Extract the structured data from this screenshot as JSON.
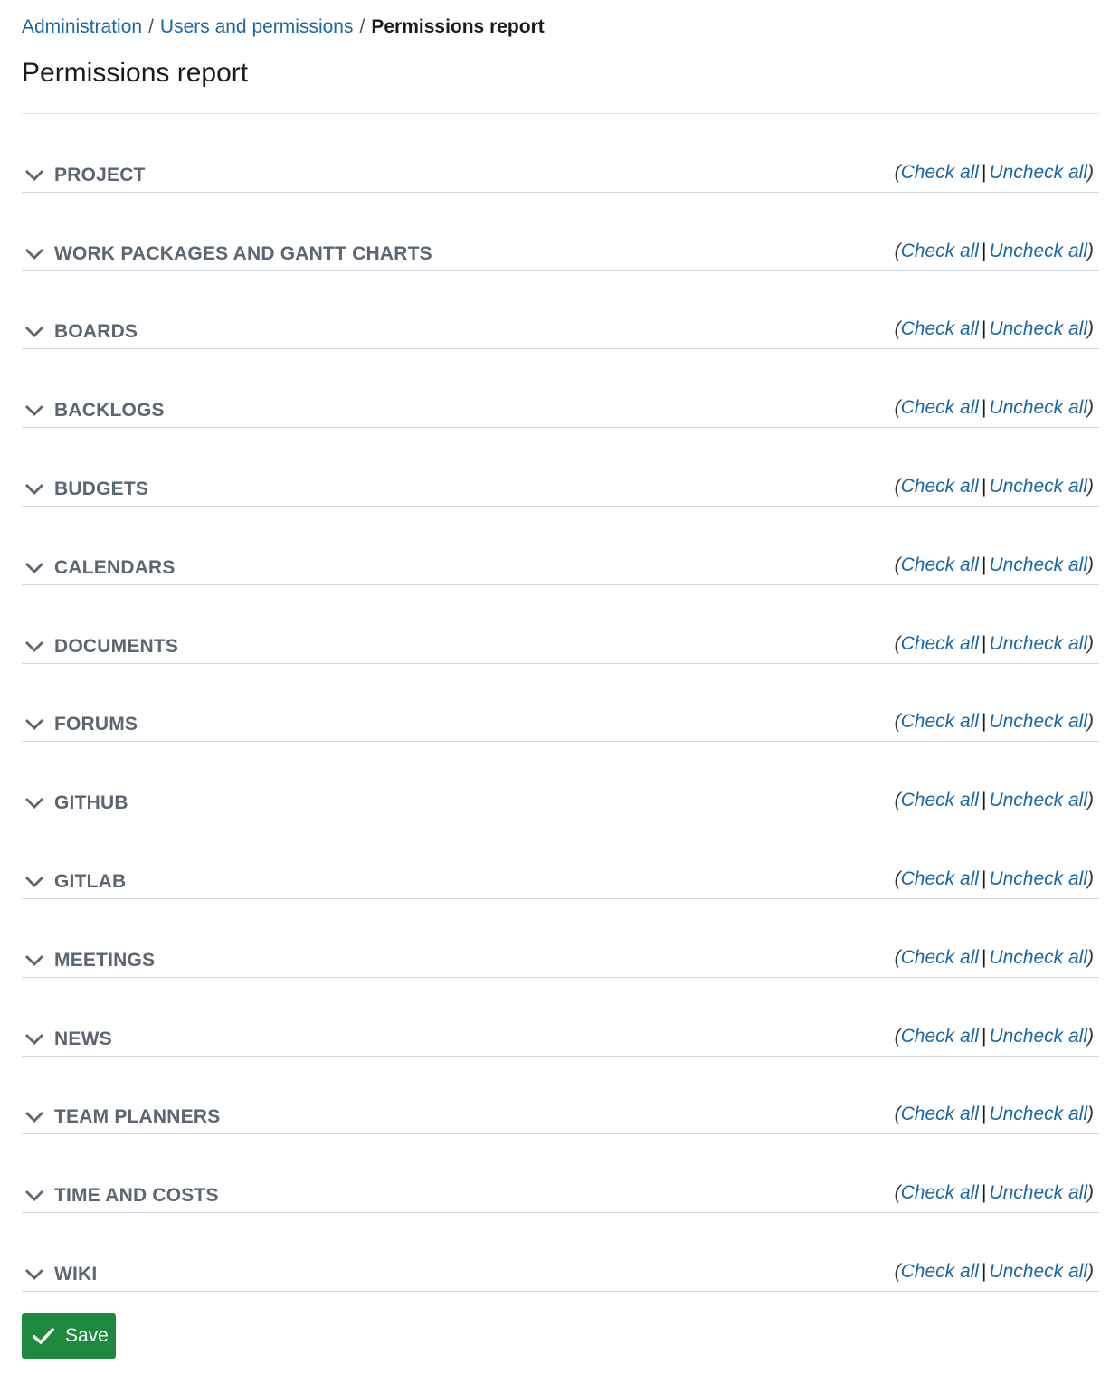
{
  "breadcrumb": {
    "items": [
      {
        "label": "Administration"
      },
      {
        "label": "Users and permissions"
      }
    ],
    "separator": "/",
    "current": "Permissions report"
  },
  "page": {
    "title": "Permissions report"
  },
  "sections": [
    {
      "label": "PROJECT",
      "expanded": true,
      "icon": "chevron-down-icon"
    },
    {
      "label": "WORK PACKAGES AND GANTT CHARTS",
      "expanded": true,
      "icon": "chevron-down-icon"
    },
    {
      "label": "BOARDS",
      "expanded": true,
      "icon": "chevron-down-icon"
    },
    {
      "label": "BACKLOGS",
      "expanded": true,
      "icon": "chevron-down-icon"
    },
    {
      "label": "BUDGETS",
      "expanded": true,
      "icon": "chevron-down-icon"
    },
    {
      "label": "CALENDARS",
      "expanded": true,
      "icon": "chevron-down-icon"
    },
    {
      "label": "DOCUMENTS",
      "expanded": true,
      "icon": "chevron-down-icon"
    },
    {
      "label": "FORUMS",
      "expanded": true,
      "icon": "chevron-down-icon"
    },
    {
      "label": "GITHUB",
      "expanded": true,
      "icon": "chevron-down-icon"
    },
    {
      "label": "GITLAB",
      "expanded": true,
      "icon": "chevron-down-icon"
    },
    {
      "label": "MEETINGS",
      "expanded": true,
      "icon": "chevron-down-icon"
    },
    {
      "label": "NEWS",
      "expanded": true,
      "icon": "chevron-down-icon"
    },
    {
      "label": "TEAM PLANNERS",
      "expanded": true,
      "icon": "chevron-down-icon"
    },
    {
      "label": "TIME AND COSTS",
      "expanded": true,
      "icon": "chevron-down-icon"
    },
    {
      "label": "WIKI",
      "expanded": true,
      "icon": "chevron-down-icon"
    }
  ],
  "section_actions": {
    "open_paren": "(",
    "check_all": "Check all",
    "pipe": "|",
    "uncheck_all": "Uncheck all",
    "close_paren": ")"
  },
  "footer": {
    "save_label": "Save",
    "save_icon": "checkmark-icon"
  },
  "colors": {
    "link": "#1a67a3",
    "section_label": "#5c6572",
    "divider": "#cfd6dd",
    "save_button": "#1f8a3f"
  }
}
